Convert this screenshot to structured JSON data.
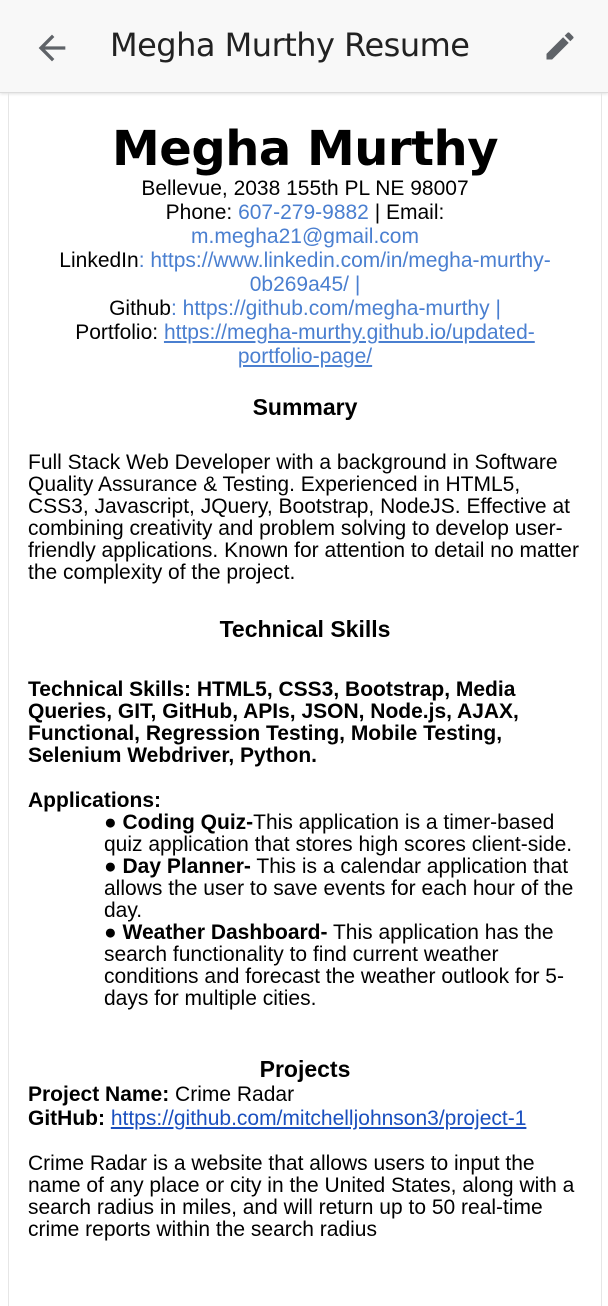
{
  "appbar": {
    "title": "Megha Murthy Resume",
    "back_icon": "arrow-left-icon",
    "edit_icon": "pencil-icon"
  },
  "resume": {
    "name": "Megha Murthy",
    "address": "Bellevue, 2038 155th PL NE  98007",
    "phone_label": "Phone: ",
    "phone": "607-279-9882",
    "email_label": " | Email:",
    "email": "m.megha21@gmail.com",
    "linkedin_label": "LinkedIn",
    "linkedin_colon": ": ",
    "linkedin_url": "https://www.linkedin.com/in/megha-murthy-0b269a45/ |",
    "github_label": "Github",
    "github_colon": ": ",
    "github_url": "https://github.com/megha-murthy |",
    "portfolio_label": "Portfolio: ",
    "portfolio_url": "https://megha-murthy.github.io/updated-portfolio-page/"
  },
  "summary": {
    "title": "Summary",
    "text": "Full Stack Web Developer with a background in Software Quality Assurance & Testing. Experienced in HTML5, CSS3, Javascript, JQuery, Bootstrap, NodeJS. Effective at combining creativity and problem solving to develop user-friendly applications. Known for attention to detail no matter the complexity of the project."
  },
  "technical_skills": {
    "title": "Technical Skills",
    "text": "Technical Skills: HTML5, CSS3, Bootstrap, Media Queries, GIT, GitHub, APIs, JSON, Node.js, AJAX, Functional, Regression Testing, Mobile Testing, Selenium Webdriver, Python.",
    "applications_title": "Applications:",
    "applications": [
      {
        "name": "● Coding Quiz-",
        "desc": "This application is a timer-based quiz application that stores high scores client-side."
      },
      {
        "name": "● Day Planner-",
        "desc": " This is a calendar application that allows the user to save events for each hour of the day."
      },
      {
        "name": "● Weather Dashboard-",
        "desc": " This application has the search functionality to find current weather conditions and forecast the weather outlook for 5-days for multiple cities."
      }
    ]
  },
  "projects": {
    "title": "Projects",
    "project_name_label": "Project Name:",
    "project_name": " Crime Radar",
    "github_label": "GitHub:",
    "github_url": "https://github.com/mitchelljohnson3/project-1",
    "description": "Crime Radar is a website that allows users to input the name of any place or city in the United States, along with a search radius in miles, and will return up to 50 real-time crime reports within the search radius"
  }
}
